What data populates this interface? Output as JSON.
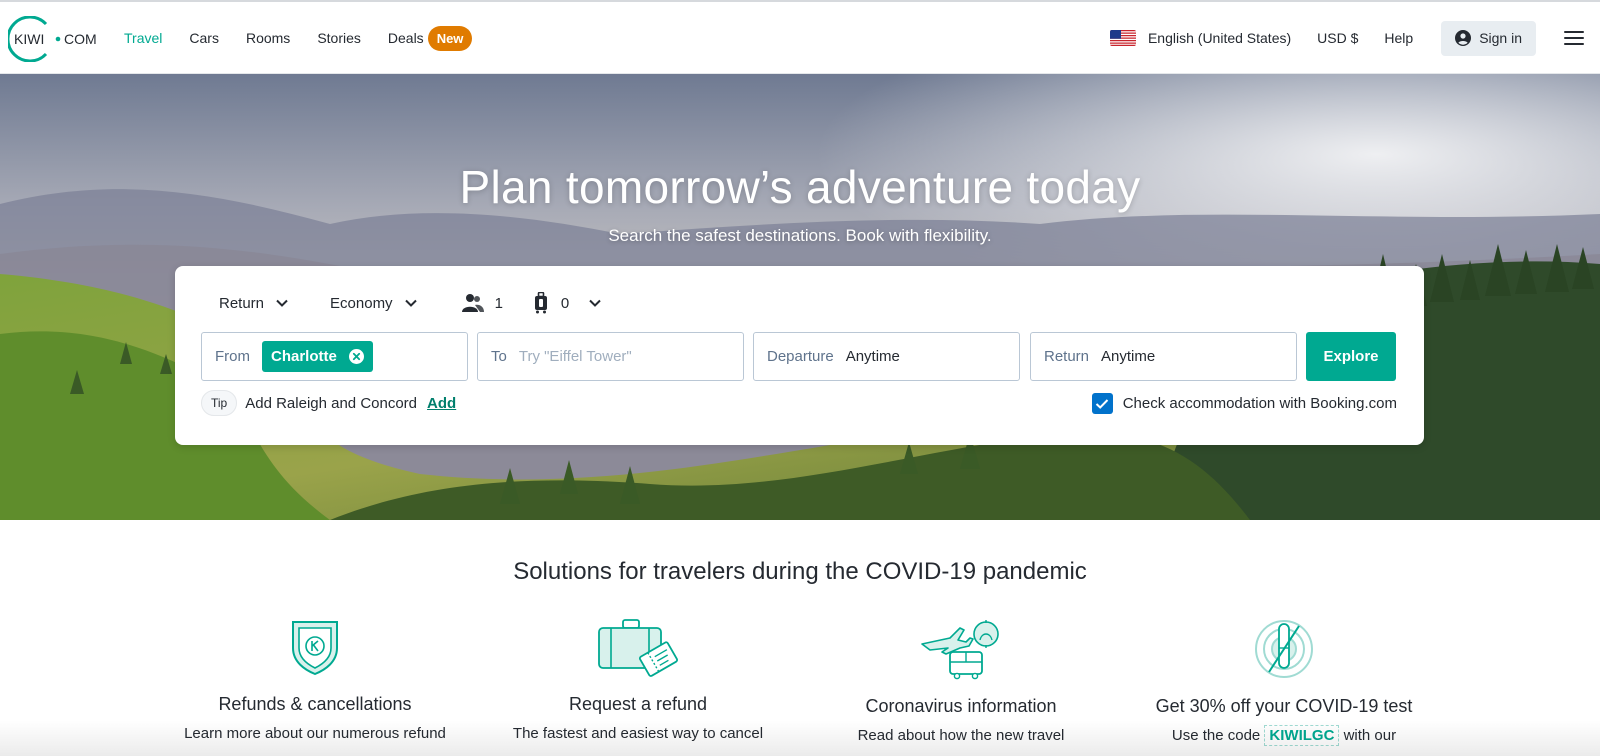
{
  "brand": {
    "logo_left": "KIWI",
    "logo_right": "COM",
    "accent": "#00a991"
  },
  "nav": {
    "items": [
      {
        "label": "Travel",
        "active": true
      },
      {
        "label": "Cars"
      },
      {
        "label": "Rooms"
      },
      {
        "label": "Stories"
      },
      {
        "label": "Deals"
      }
    ],
    "deals_badge": "New",
    "badge_color": "#e07b00"
  },
  "header_right": {
    "flag_icon": "us-flag-icon",
    "language": "English (United States)",
    "currency": "USD $",
    "help": "Help",
    "signin": "Sign in"
  },
  "hero": {
    "title": "Plan tomorrow’s adventure today",
    "subtitle": "Search the safest destinations. Book with flexibility."
  },
  "search": {
    "trip_type": "Return",
    "cabin": "Economy",
    "passengers": "1",
    "bags": "0",
    "from_label": "From",
    "from_value": "Charlotte",
    "to_label": "To",
    "to_placeholder": "Try \"Eiffel Tower\"",
    "departure_label": "Departure",
    "departure_value": "Anytime",
    "return_label": "Return",
    "return_value": "Anytime",
    "explore": "Explore",
    "tip_badge": "Tip",
    "tip_text": "Add Raleigh and Concord",
    "tip_link": "Add",
    "booking_checked": true,
    "booking_label": "Check accommodation with Booking.com",
    "checkbox_color": "#0172cb"
  },
  "solutions": {
    "title": "Solutions for travelers during the COVID-19 pandemic",
    "items": [
      {
        "icon": "shield-k-icon",
        "title": "Refunds & cancellations",
        "text": "Learn more about our numerous refund"
      },
      {
        "icon": "luggage-ticket-icon",
        "title": "Request a refund",
        "text": "The fastest and easiest way to cancel"
      },
      {
        "icon": "plane-bus-icon",
        "title": "Coronavirus information",
        "text": "Read about how the new travel"
      },
      {
        "icon": "test-tube-icon",
        "title": "Get 30% off your COVID-19 test",
        "text_before": "Use the code",
        "code": "KIWILGC",
        "text_after": "with our"
      }
    ]
  }
}
